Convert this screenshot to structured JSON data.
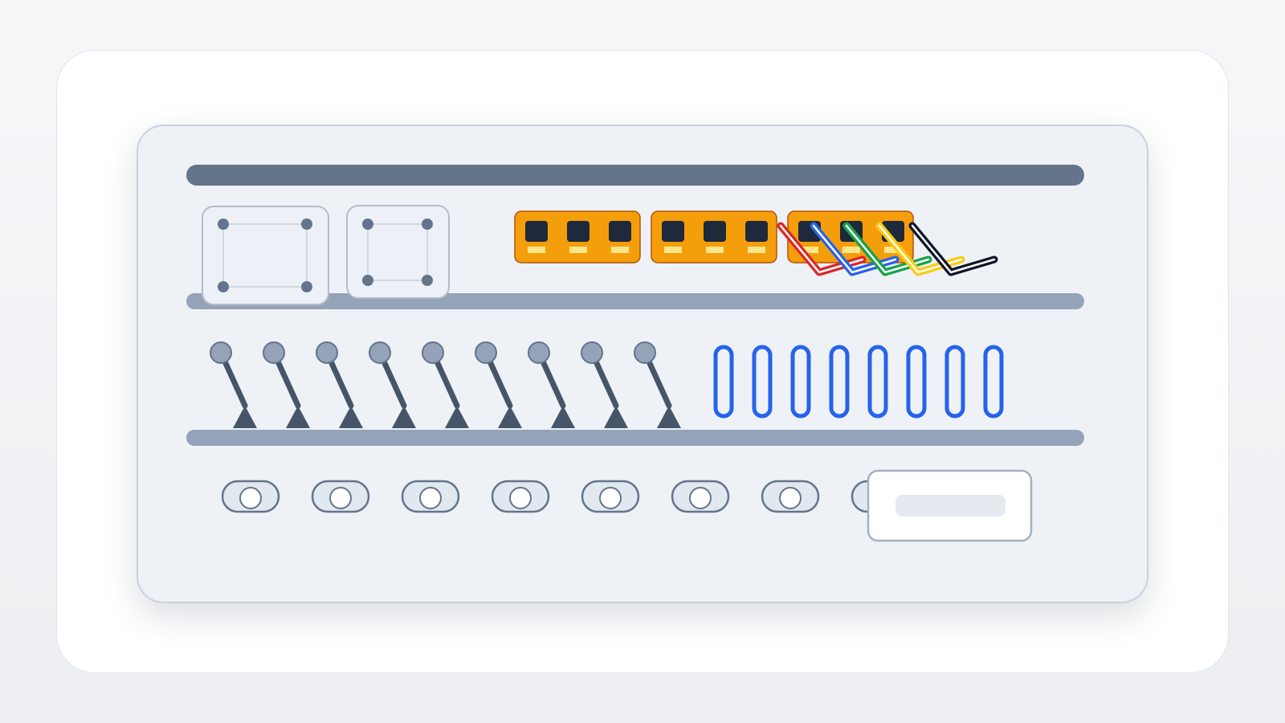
{
  "scene": {
    "colors": {
      "page_background": "#f2f4f7",
      "card_background": "#ffffff",
      "panel_background": "#eef1f6",
      "top_rail": "#64748b",
      "shelf_rail": "#94a3b8",
      "switch_bank_orange": "#f59e0b",
      "port_dark": "#1e293b",
      "toggle_slot_blue": "#2563eb",
      "cable_red": "#dc2626",
      "cable_blue": "#2563eb",
      "cable_green": "#16a34a",
      "cable_yellow": "#facc15",
      "cable_black": "#0f172a"
    },
    "top_shelf": {
      "mount_plates": [
        {
          "icon": "mount-plate-icon"
        },
        {
          "icon": "mount-plate-icon"
        }
      ],
      "switch_banks": [
        {
          "ports": 3
        },
        {
          "ports": 3
        },
        {
          "ports": 3
        }
      ],
      "patch_cables": [
        "red",
        "blue",
        "green",
        "yellow",
        "black"
      ]
    },
    "middle_shelf": {
      "levers": 9,
      "toggle_slots": 8
    },
    "bottom_shelf": {
      "rocker_switches": 8,
      "display_panel": {
        "icon": "display-panel-icon"
      }
    }
  }
}
